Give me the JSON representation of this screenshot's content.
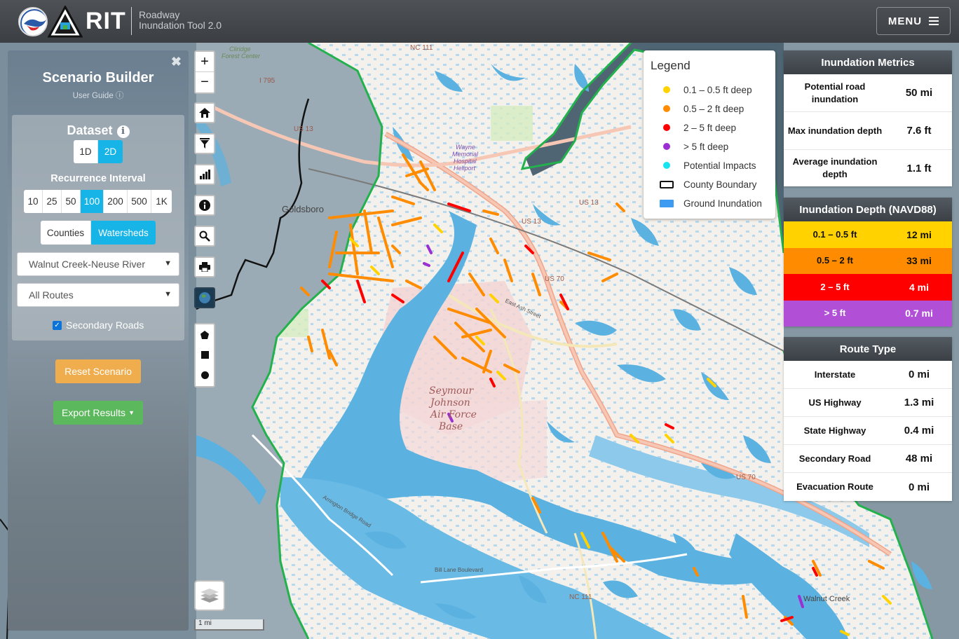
{
  "header": {
    "app_short": "RIT",
    "subtitle_line1": "Roadway",
    "subtitle_line2": "Inundation Tool 2.0",
    "menu_label": "MENU",
    "logo_text": "NORTH CAROLINA"
  },
  "scenario": {
    "title": "Scenario Builder",
    "user_guide": "User Guide",
    "dataset_title": "Dataset",
    "dataset_options": [
      "1D",
      "2D"
    ],
    "dataset_selected": "2D",
    "recurrence_title": "Recurrence Interval",
    "recurrence_options": [
      "10",
      "25",
      "50",
      "100",
      "200",
      "500",
      "1K"
    ],
    "recurrence_selected": "100",
    "area_options": [
      "Counties",
      "Watersheds"
    ],
    "area_selected": "Watersheds",
    "watershed_select": "Walnut Creek-Neuse River",
    "routes_select": "All Routes",
    "secondary_roads_label": "Secondary Roads",
    "secondary_roads_checked": true,
    "reset_label": "Reset Scenario",
    "export_label": "Export Results"
  },
  "map": {
    "scale_label": "1 mi",
    "labels": {
      "goldsboro": "Goldsboro",
      "walnut_creek": "Walnut Creek",
      "seymour1": "Seymour",
      "seymour2": "Johnson",
      "seymour3": "Air Force",
      "seymour4": "Base",
      "hospital1": "Wayne",
      "hospital2": "Memorial",
      "hospital3": "Hospital",
      "hospital4": "Heliport",
      "us13_a": "US 13",
      "us13_b": "US 13",
      "us13_us70": "US 13",
      "us70_a": "US 70",
      "us70_b": "US 70",
      "nc111_a": "NC 111",
      "nc111_b": "NC 111",
      "i795": "I 795",
      "arrington": "Arrington Bridge Road",
      "bill_lane": "Bill Lane Boulevard",
      "east_ash": "East Ash Street",
      "cliridge": "Cliridge",
      "forest_center": "Forest Center"
    },
    "colors": {
      "water": "#5bb2e0",
      "boundary": "#22b14c",
      "depth_low": "#ffd200",
      "depth_mid": "#ff8c00",
      "depth_high": "#ff0000",
      "depth_extreme": "#9b2fd1"
    }
  },
  "legend": {
    "title": "Legend",
    "items": [
      {
        "label": "0.1 – 0.5 ft deep",
        "color": "#ffd200",
        "icon": "dot"
      },
      {
        "label": "0.5 – 2 ft deep",
        "color": "#ff8c00",
        "icon": "dot"
      },
      {
        "label": "2 – 5 ft deep",
        "color": "#ff0000",
        "icon": "dot"
      },
      {
        "label": "> 5 ft deep",
        "color": "#9b2fd1",
        "icon": "dot"
      },
      {
        "label": "Potential Impacts",
        "color": "#17e4f0",
        "icon": "dot"
      },
      {
        "label": "County Boundary",
        "color": "#000000",
        "icon": "outline"
      },
      {
        "label": "Ground Inundation",
        "color": "#3d9cf2",
        "icon": "fill"
      }
    ]
  },
  "metrics": {
    "title": "Inundation Metrics",
    "rows": [
      {
        "label": "Potential road inundation",
        "value": "50 mi"
      },
      {
        "label": "Max inundation depth",
        "value": "7.6 ft"
      },
      {
        "label": "Average inundation depth",
        "value": "1.1 ft"
      }
    ]
  },
  "depth": {
    "title": "Inundation Depth (NAVD88)",
    "rows": [
      {
        "label": "0.1 – 0.5 ft",
        "value": "12 mi",
        "color": "#ffd200",
        "text": "#111"
      },
      {
        "label": "0.5 – 2 ft",
        "value": "33 mi",
        "color": "#ff8c00",
        "text": "#111"
      },
      {
        "label": "2 – 5 ft",
        "value": "4 mi",
        "color": "#ff0000",
        "text": "#fff"
      },
      {
        "label": "> 5 ft",
        "value": "0.7 mi",
        "color": "#b150d6",
        "text": "#fff"
      }
    ]
  },
  "route_type": {
    "title": "Route Type",
    "rows": [
      {
        "label": "Interstate",
        "value": "0 mi"
      },
      {
        "label": "US Highway",
        "value": "1.3 mi"
      },
      {
        "label": "State Highway",
        "value": "0.4 mi"
      },
      {
        "label": "Secondary Road",
        "value": "48 mi"
      },
      {
        "label": "Evacuation Route",
        "value": "0 mi"
      }
    ]
  }
}
